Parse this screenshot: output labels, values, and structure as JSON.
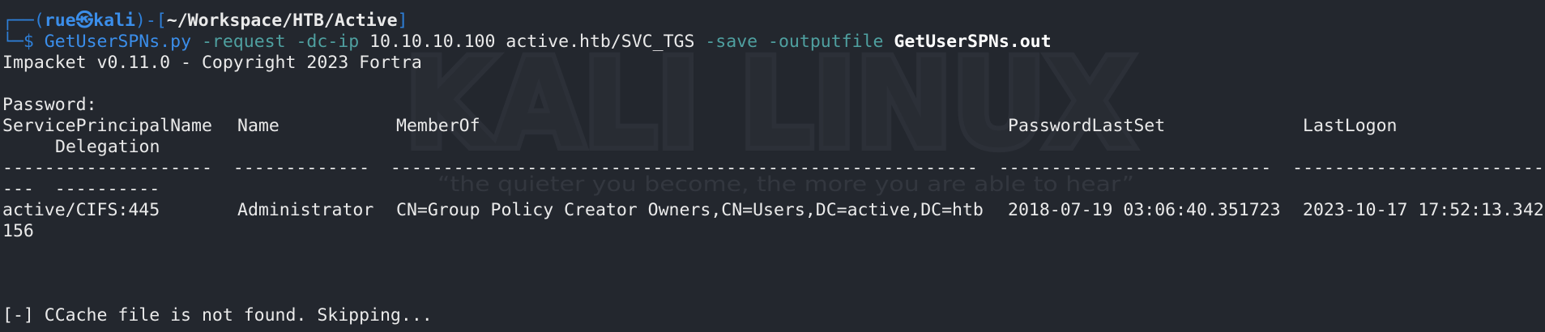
{
  "prompt": {
    "frame_top": "┌──(",
    "user": "rue",
    "skull_glyph": "㉿",
    "host": "kali",
    "frame_mid": ")-[",
    "path": "~/Workspace/HTB/Active",
    "frame_close": "]",
    "frame_bottom": "└─$",
    "command": "GetUserSPNs.py",
    "opt_request": "-request",
    "opt_dcip": "-dc-ip",
    "ip": "10.10.10.100",
    "target": "active.htb/SVC_TGS",
    "opt_save": "-save",
    "opt_output": "-outputfile",
    "outfile": "GetUserSPNs.out"
  },
  "output": {
    "banner": "Impacket v0.11.0 - Copyright 2023 Fortra",
    "password_prompt": "Password:",
    "table": {
      "headers": [
        "ServicePrincipalName",
        "Name",
        "MemberOf",
        "PasswordLastSet",
        "LastLogon",
        "Delegation"
      ],
      "separator_1": "--------------------  -------------  --------------------------------------------------------  --------------------------  -----------------------------",
      "separator_2": "---  ----------",
      "rows": [
        {
          "spn": "active/CIFS:445",
          "name": "Administrator",
          "memberof": "CN=Group Policy Creator Owners,CN=Users,DC=active,DC=htb",
          "passwordlastset": "2018-07-19 03:06:40.351723",
          "lastlogon": "2023-10-17 17:52:13.342",
          "lastlogon_wrap": "156"
        }
      ]
    },
    "error": "[-] CCache file is not found. Skipping..."
  },
  "watermark": {
    "title": "KALI LINUX",
    "tagline": "“the quieter you become, the more you are able to hear”"
  }
}
